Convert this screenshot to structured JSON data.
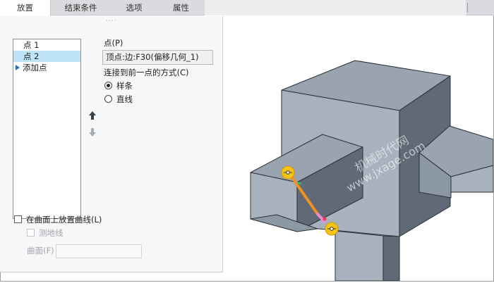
{
  "tabs": [
    {
      "label": "放置",
      "active": true
    },
    {
      "label": "结束条件",
      "active": false
    },
    {
      "label": "选项",
      "active": false
    },
    {
      "label": "属性",
      "active": false
    }
  ],
  "panel": {
    "grip": "····",
    "points": [
      {
        "label": "点 1",
        "selected": false
      },
      {
        "label": "点 2",
        "selected": true
      }
    ],
    "add_point": "添加点",
    "point_label": "点(P)",
    "point_value": "顶点:边:F30(偏移几何_1)",
    "connect_label": "连接到前一点的方式(C)",
    "connect_options": [
      {
        "label": "样条",
        "checked": true
      },
      {
        "label": "直线",
        "checked": false
      }
    ],
    "place_on_surface": "在曲面上放置曲线(L)",
    "geodesic": "测地线",
    "surface_label": "曲面(F)"
  },
  "viewport": {
    "watermark_cn": "机械时代网",
    "watermark_url": "www.jxage.com",
    "colors": {
      "face_top": "#9aa4b1",
      "face_front": "#a7b2be",
      "face_side": "#5f6a76",
      "edge": "#2a2f35",
      "curve_orange": "#f0921e",
      "curve_pink": "#e98fd0",
      "handle_yellow": "#f5c515"
    }
  }
}
